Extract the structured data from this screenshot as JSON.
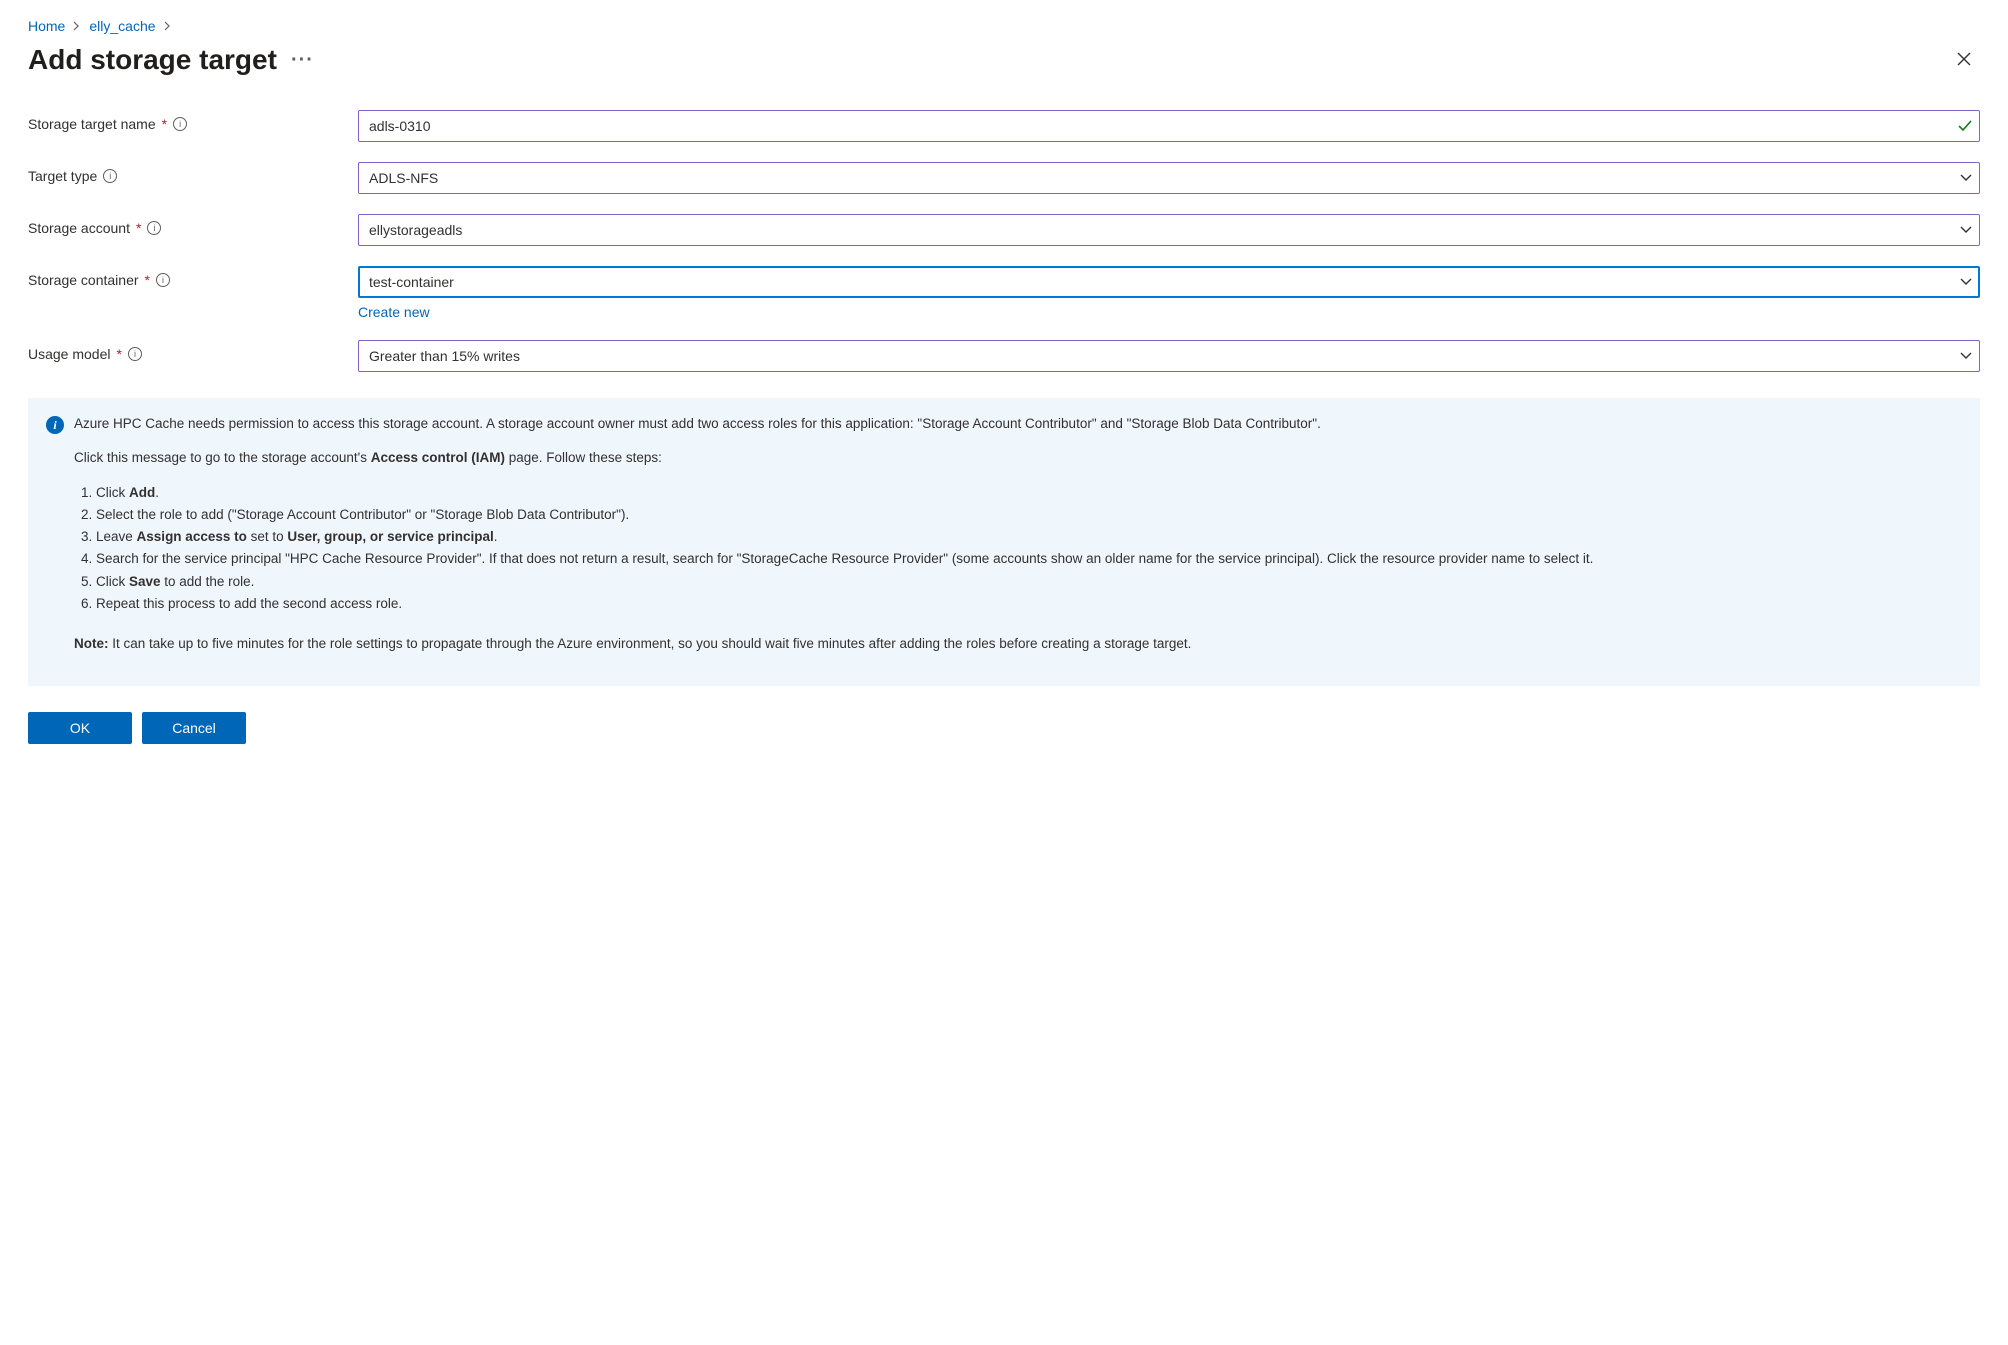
{
  "breadcrumb": {
    "home": "Home",
    "cache": "elly_cache"
  },
  "page": {
    "title": "Add storage target"
  },
  "form": {
    "name": {
      "label": "Storage target name",
      "value": "adls-0310",
      "required": true
    },
    "type": {
      "label": "Target type",
      "value": "ADLS-NFS",
      "required": false
    },
    "account": {
      "label": "Storage account",
      "value": "ellystorageadls",
      "required": true
    },
    "container": {
      "label": "Storage container",
      "value": "test-container",
      "required": true,
      "create_new": "Create new"
    },
    "usage": {
      "label": "Usage model",
      "value": "Greater than 15% writes",
      "required": true
    }
  },
  "info": {
    "p1_a": "Azure HPC Cache needs permission to access this storage account. A storage account owner must add two access roles for this application: \"Storage Account Contributor\" and \"Storage Blob Data Contributor\".",
    "p2_a": "Click this message to go to the storage account's ",
    "p2_b": "Access control (IAM)",
    "p2_c": " page. Follow these steps:",
    "steps": {
      "s1a": " Click ",
      "s1b": "Add",
      "s1c": ".",
      "s2": " Select the role to add (\"Storage Account Contributor\" or \"Storage Blob Data Contributor\").",
      "s3a": "Leave ",
      "s3b": "Assign access to",
      "s3c": " set to ",
      "s3d": "User, group, or service principal",
      "s3e": ".",
      "s4": "Search for the service principal \"HPC Cache Resource Provider\". If that does not return a result, search for \"StorageCache Resource Provider\" (some accounts show an older name for the service principal). Click the resource provider name to select it.",
      "s5a": "Click ",
      "s5b": "Save",
      "s5c": " to add the role.",
      "s6": "Repeat this process to add the second access role."
    },
    "note_label": "Note:",
    "note": " It can take up to five minutes for the role settings to propagate through the Azure environment, so you should wait five minutes after adding the roles before creating a storage target."
  },
  "footer": {
    "ok": "OK",
    "cancel": "Cancel"
  }
}
